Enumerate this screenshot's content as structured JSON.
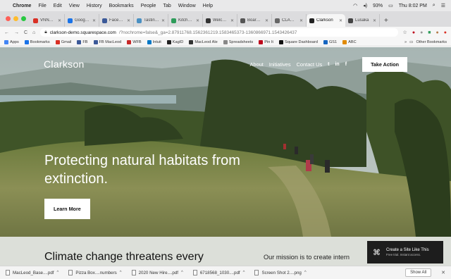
{
  "menubar": {
    "app": "Chrome",
    "menus": [
      "File",
      "Edit",
      "View",
      "History",
      "Bookmarks",
      "People",
      "Tab",
      "Window",
      "Help"
    ],
    "battery": "93%",
    "clock": "Thu 8:02 PM"
  },
  "tabs": [
    {
      "label": "VNNC Cal",
      "color": "#d93025"
    },
    {
      "label": "Google Ca",
      "color": "#1a73e8"
    },
    {
      "label": "Facebook",
      "color": "#3b5998"
    },
    {
      "label": "Tasting Ro",
      "color": "#4a90c2"
    },
    {
      "label": "Kitchen St",
      "color": "#2e9c5a"
    },
    {
      "label": "Welcome",
      "color": "#333333"
    },
    {
      "label": "Board of T",
      "color": "#555555"
    },
    {
      "label": "CLARKSO",
      "color": "#666666"
    },
    {
      "label": "Clarkson",
      "color": "#222222",
      "active": true
    },
    {
      "label": "Lusaka",
      "color": "#444444"
    }
  ],
  "address": {
    "host": "clarkson-demo.squarespace.com",
    "path": "/?nochrome=false&_ga=2.87911768.1562361219.1583465373-1360866971.1543426437"
  },
  "bookmarks": [
    {
      "label": "Apps",
      "color": "#4285f4"
    },
    {
      "label": "Bookmarks",
      "color": "#1a73e8"
    },
    {
      "label": "Gmail",
      "color": "#d93025"
    },
    {
      "label": "FB",
      "color": "#3b5998"
    },
    {
      "label": "FB MacLeod",
      "color": "#3b5998"
    },
    {
      "label": "WFB",
      "color": "#c62828"
    },
    {
      "label": "Intuit",
      "color": "#0077c5"
    },
    {
      "label": "KagID",
      "color": "#222222"
    },
    {
      "label": "MacLeod Ale",
      "color": "#333333"
    },
    {
      "label": "Spreadsheets",
      "color": "#888888"
    },
    {
      "label": "Pin It",
      "color": "#bd081c"
    },
    {
      "label": "Square Dashboard",
      "color": "#111111"
    },
    {
      "label": "GS1",
      "color": "#1565c0"
    },
    {
      "label": "ABC",
      "color": "#e08a00"
    }
  ],
  "other_bookmarks": "Other Bookmarks",
  "site": {
    "logo": "Clarkson",
    "nav": [
      "About",
      "Initiatives",
      "Contact Us"
    ],
    "social": [
      "twitter-icon",
      "linkedin-icon",
      "facebook-icon"
    ],
    "social_glyphs": [
      "t",
      "in",
      "f"
    ],
    "cta": "Take Action",
    "hero_title": "Protecting natural habitats from extinction.",
    "hero_button": "Learn More",
    "band_heading": "Climate change threatens every",
    "band_mission": "Our mission is to create intern"
  },
  "squarespace_badge": {
    "title": "Create a Site Like This",
    "subtitle": "Free trial. Instant access."
  },
  "downloads": [
    "MacLeod_Base....pdf",
    "Pizza Box....numbers",
    "2020 New Hire....pdf",
    "6718568_1030....pdf",
    "Screen Shot 2....png"
  ],
  "show_all": "Show All"
}
